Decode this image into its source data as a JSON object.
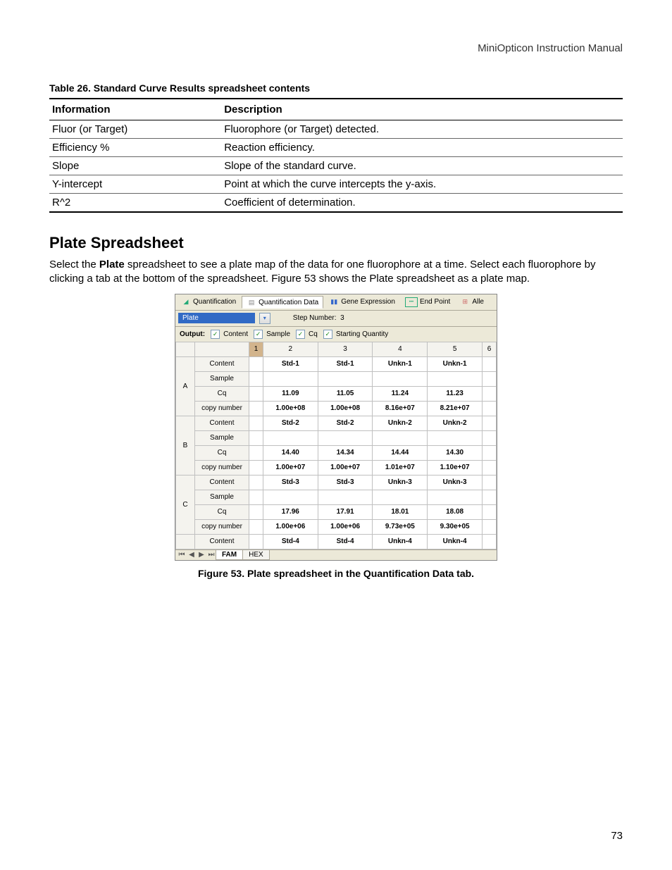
{
  "header": "MiniOpticon Instruction Manual",
  "table26": {
    "caption": "Table 26. Standard Curve Results spreadsheet contents",
    "col1": "Information",
    "col2": "Description",
    "rows": [
      {
        "info": "Fluor (or Target)",
        "desc": "Fluorophore (or Target) detected."
      },
      {
        "info": "Efficiency %",
        "desc": "Reaction efficiency."
      },
      {
        "info": "Slope",
        "desc": "Slope of the standard curve."
      },
      {
        "info": "Y-intercept",
        "desc": "Point at which the curve intercepts the y-axis."
      },
      {
        "info": "R^2",
        "desc": "Coefficient of determination."
      }
    ]
  },
  "section_title": "Plate Spreadsheet",
  "para1a": "Select the ",
  "para1b": "Plate",
  "para1c": " spreadsheet to see a plate map of the data for one fluorophore at a time. Select each fluorophore by clicking a tab at the bottom of the spreadsheet. Figure 53 shows the Plate spreadsheet as a plate map.",
  "shot": {
    "tabs": {
      "quant": "Quantification",
      "quant_data": "Quantification Data",
      "gene": "Gene Expression",
      "endpoint": "End Point",
      "alle": "Alle"
    },
    "plate_label": "Plate",
    "step_label": "Step Number:",
    "step_value": "3",
    "output_label": "Output:",
    "checks": {
      "content": "Content",
      "sample": "Sample",
      "cq": "Cq",
      "sq": "Starting Quantity"
    },
    "col_headers": [
      "1",
      "2",
      "3",
      "4",
      "5",
      "6"
    ],
    "row_labels": {
      "content": "Content",
      "sample": "Sample",
      "cq": "Cq",
      "copy": "copy number"
    },
    "rows": [
      {
        "id": "A",
        "content": [
          "",
          "Std-1",
          "Std-1",
          "Unkn-1",
          "Unkn-1",
          ""
        ],
        "sample": [
          "",
          "",
          "",
          "",
          "",
          ""
        ],
        "cq": [
          "",
          "11.09",
          "11.05",
          "11.24",
          "11.23",
          ""
        ],
        "copy": [
          "",
          "1.00e+08",
          "1.00e+08",
          "8.16e+07",
          "8.21e+07",
          ""
        ]
      },
      {
        "id": "B",
        "content": [
          "",
          "Std-2",
          "Std-2",
          "Unkn-2",
          "Unkn-2",
          ""
        ],
        "sample": [
          "",
          "",
          "",
          "",
          "",
          ""
        ],
        "cq": [
          "",
          "14.40",
          "14.34",
          "14.44",
          "14.30",
          ""
        ],
        "copy": [
          "",
          "1.00e+07",
          "1.00e+07",
          "1.01e+07",
          "1.10e+07",
          ""
        ]
      },
      {
        "id": "C",
        "content": [
          "",
          "Std-3",
          "Std-3",
          "Unkn-3",
          "Unkn-3",
          ""
        ],
        "sample": [
          "",
          "",
          "",
          "",
          "",
          ""
        ],
        "cq": [
          "",
          "17.96",
          "17.91",
          "18.01",
          "18.08",
          ""
        ],
        "copy": [
          "",
          "1.00e+06",
          "1.00e+06",
          "9.73e+05",
          "9.30e+05",
          ""
        ]
      }
    ],
    "partial_row": {
      "content": [
        "",
        "Std-4",
        "Std-4",
        "Unkn-4",
        "Unkn-4",
        ""
      ]
    },
    "sheet_tabs": {
      "fam": "FAM",
      "hex": "HEX"
    }
  },
  "figure_caption": "Figure 53. Plate spreadsheet in the Quantification Data tab.",
  "page_number": "73"
}
